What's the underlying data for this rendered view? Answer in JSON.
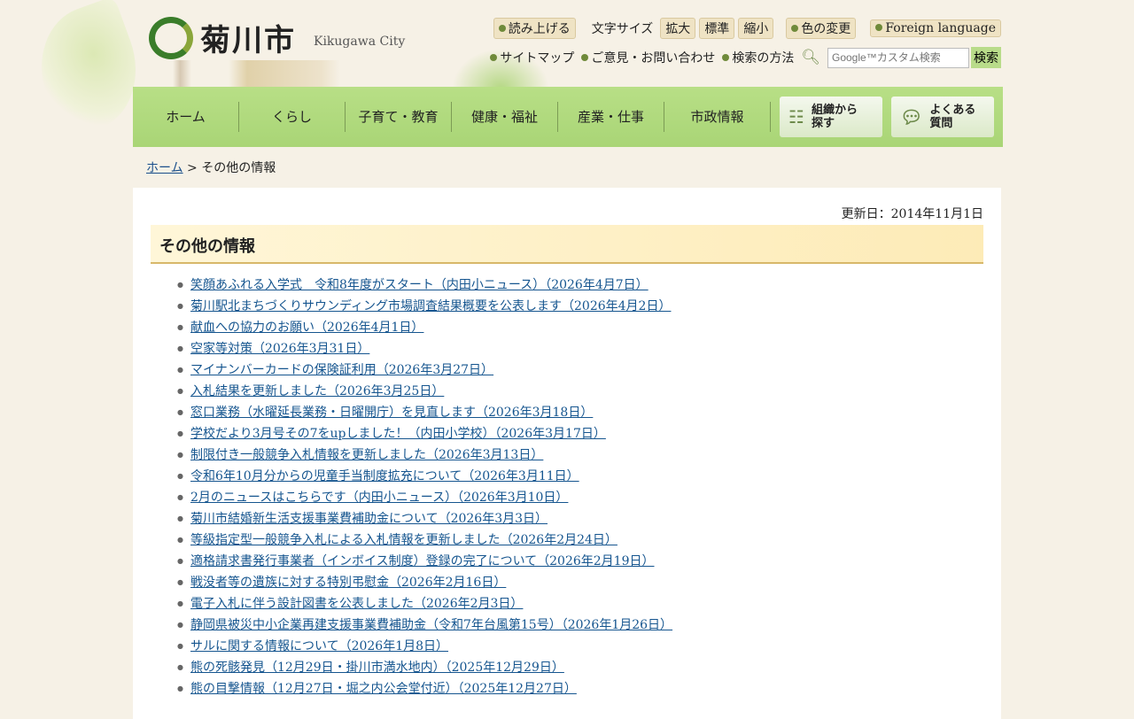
{
  "header": {
    "logo_text": "菊川市",
    "logo_en": "Kikugawa City",
    "util": {
      "read": "読み上げる",
      "font_size_label": "文字サイズ",
      "enlarge": "拡大",
      "standard": "標準",
      "shrink": "縮小",
      "color": "色の変更",
      "foreign": "Foreign language"
    },
    "links": {
      "sitemap": "サイトマップ",
      "contact": "ご意見・お問い合わせ",
      "search_help": "検索の方法"
    },
    "search": {
      "placeholder": "Google™カスタム検索",
      "button": "検索"
    }
  },
  "nav": [
    "ホーム",
    "くらし",
    "子育て・教育",
    "健康・福祉",
    "産業・仕事",
    "市政情報"
  ],
  "nav_special": {
    "org": "組織から探す",
    "faq": "よくある質問"
  },
  "breadcrumb": {
    "home": "ホーム",
    "sep": ">",
    "current": "その他の情報"
  },
  "main": {
    "updated": "更新日：2014年11月1日",
    "title": "その他の情報",
    "items": [
      "笑顔あふれる入学式　令和8年度がスタート（内田小ニュース）（2026年4月7日）",
      "菊川駅北まちづくりサウンディング市場調査結果概要を公表します（2026年4月2日）",
      "献血への協力のお願い（2026年4月1日）",
      "空家等対策（2026年3月31日）",
      "マイナンバーカードの保険証利用（2026年3月27日）",
      "入札結果を更新しました（2026年3月25日）",
      "窓口業務（水曜延長業務・日曜開庁）を見直します（2026年3月18日）",
      "学校だより3月号その7をupしました！（内田小学校）（2026年3月17日）",
      "制限付き一般競争入札情報を更新しました（2026年3月13日）",
      "令和6年10月分からの児童手当制度拡充について（2026年3月11日）",
      "2月のニュースはこちらです（内田小ニュース）（2026年3月10日）",
      "菊川市結婚新生活支援事業費補助金について（2026年3月3日）",
      "等級指定型一般競争入札による入札情報を更新しました（2026年2月24日）",
      "適格請求書発行事業者（インボイス制度）登録の完了について（2026年2月19日）",
      "戦没者等の遺族に対する特別弔慰金（2026年2月16日）",
      "電子入札に伴う設計図書を公表しました（2026年2月3日）",
      "静岡県被災中小企業再建支援事業費補助金（令和7年台風第15号）（2026年1月26日）",
      "サルに関する情報について（2026年1月8日）",
      "熊の死骸発見（12月29日・掛川市満水地内）（2025年12月29日）",
      "熊の目撃情報（12月27日・堀之内公会堂付近）（2025年12月27日）"
    ]
  }
}
